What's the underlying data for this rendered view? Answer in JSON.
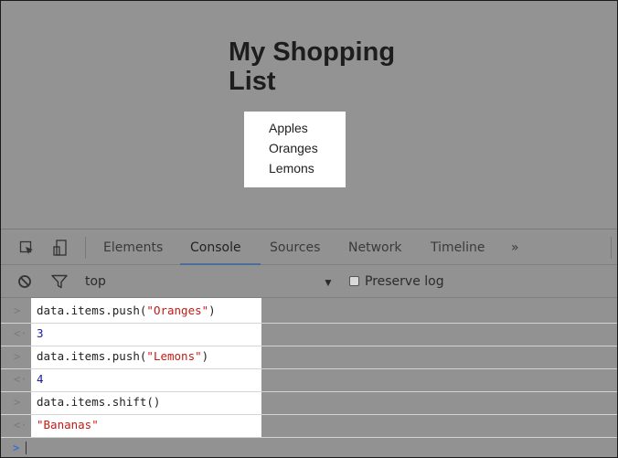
{
  "page": {
    "title": "My Shopping List",
    "items": [
      "Apples",
      "Oranges",
      "Lemons"
    ]
  },
  "devtools": {
    "tabs": [
      {
        "label": "Elements",
        "active": false
      },
      {
        "label": "Console",
        "active": true
      },
      {
        "label": "Sources",
        "active": false
      },
      {
        "label": "Network",
        "active": false
      },
      {
        "label": "Timeline",
        "active": false
      }
    ],
    "more_tabs": "»",
    "context": "top",
    "dropdown_arrow": "▼",
    "preserve_log_label": "Preserve log",
    "preserve_log_checked": false,
    "console": [
      {
        "input": "data.items.push(",
        "arg": "\"Oranges\"",
        "close": ")",
        "result": "3",
        "result_type": "number"
      },
      {
        "input": "data.items.push(",
        "arg": "\"Lemons\"",
        "close": ")",
        "result": "4",
        "result_type": "number"
      },
      {
        "input": "data.items.shift()",
        "arg": "",
        "close": "",
        "result": "\"Bananas\"",
        "result_type": "string"
      }
    ],
    "input_glyph": ">",
    "output_glyph": "<·",
    "prompt_glyph": ">"
  },
  "colors": {
    "background": "#939393",
    "tab_active_underline": "#4c6e9b",
    "number": "#1a1aa6",
    "string": "#c41a16",
    "prompt": "#3b6fd1"
  }
}
